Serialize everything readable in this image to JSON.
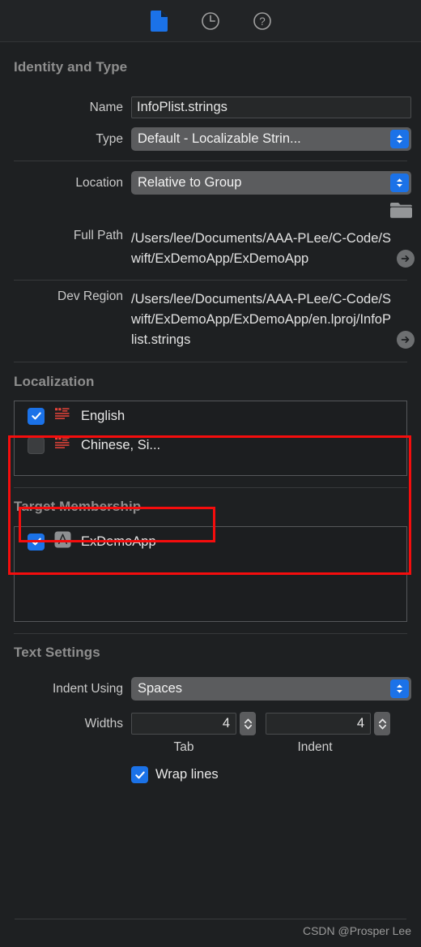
{
  "toolbar": {
    "tabs": [
      {
        "name": "file-inspector-tab",
        "icon": "document-icon",
        "selected": true
      },
      {
        "name": "history-inspector-tab",
        "icon": "clock-icon",
        "selected": false
      },
      {
        "name": "quick-help-inspector-tab",
        "icon": "question-mark-icon",
        "selected": false
      }
    ]
  },
  "identity": {
    "title": "Identity and Type",
    "name_label": "Name",
    "name_value": "InfoPlist.strings",
    "type_label": "Type",
    "type_value": "Default - Localizable Strin...",
    "location_label": "Location",
    "location_value": "Relative to Group",
    "full_path_label": "Full Path",
    "full_path_value": "/Users/lee/Documents/AAA-PLee/C-Code/Swift/ExDemoApp/ExDemoApp",
    "dev_region_label": "Dev Region",
    "dev_region_value": "/Users/lee/Documents/AAA-PLee/C-Code/Swift/ExDemoApp/ExDemoApp/en.lproj/InfoPlist.strings"
  },
  "localization": {
    "title": "Localization",
    "items": [
      {
        "label": "English",
        "checked": true,
        "icon": "strings-file-icon"
      },
      {
        "label": "Chinese, Si...",
        "checked": false,
        "icon": "strings-file-icon"
      }
    ]
  },
  "target_membership": {
    "title": "Target Membership",
    "items": [
      {
        "label": "ExDemoApp",
        "checked": true,
        "icon": "app-target-icon"
      }
    ]
  },
  "text_settings": {
    "title": "Text Settings",
    "indent_using_label": "Indent Using",
    "indent_using_value": "Spaces",
    "widths_label": "Widths",
    "tab_value": "4",
    "tab_sublabel": "Tab",
    "indent_value": "4",
    "indent_sublabel": "Indent",
    "wrap_lines_label": "Wrap lines",
    "wrap_lines_checked": true
  },
  "watermark": "CSDN @Prosper Lee",
  "colors": {
    "accent_blue": "#1b72e8",
    "panel_bg": "#1e2022",
    "annotation_red": "#f50d0d",
    "strings_icon_red": "#e8443a"
  }
}
